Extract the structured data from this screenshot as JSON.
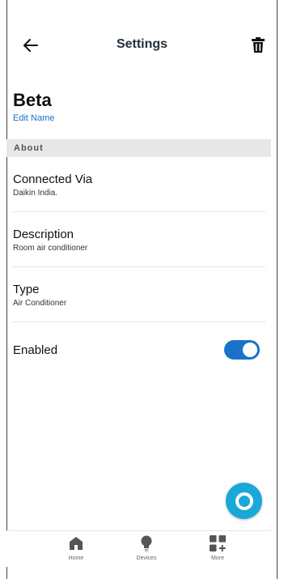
{
  "header": {
    "title": "Settings",
    "back_icon": "arrow-left-icon",
    "delete_icon": "trash-icon"
  },
  "device": {
    "name": "Beta",
    "edit_label": "Edit Name"
  },
  "section": {
    "about": "About"
  },
  "rows": [
    {
      "title": "Connected Via",
      "value": "Daikin India."
    },
    {
      "title": "Description",
      "value": "Room air conditioner"
    },
    {
      "title": "Type",
      "value": "Air Conditioner"
    }
  ],
  "enabled": {
    "label": "Enabled",
    "state": true
  },
  "nav": {
    "items": [
      {
        "label": "Home",
        "icon": "home-icon"
      },
      {
        "label": "Devices",
        "icon": "bulb-icon"
      },
      {
        "label": "More",
        "icon": "grid-plus-icon"
      }
    ]
  },
  "colors": {
    "accent": "#1a73c9",
    "alexa": "#1aa8d9"
  }
}
